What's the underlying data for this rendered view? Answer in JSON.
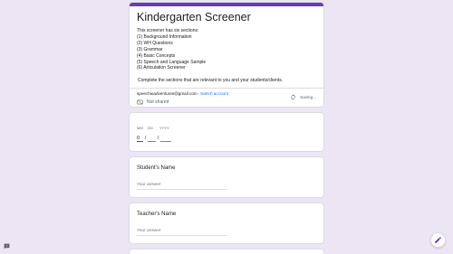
{
  "form": {
    "title": "Kindergarten Screener",
    "description_lines": [
      "This screener has six sections:",
      "(1) Background Information",
      "(2) WH Questions",
      "(3) Grammar",
      "(4) Basic Concepts",
      "(5) Speech and Language Sample",
      "(6) Articulation Screener"
    ],
    "instruction": "Complete the sections that are relevant to you and your students/clients.",
    "account_email": "speechieadventures@gmail.com",
    "switch_account_label": "Switch account",
    "saving_status": "Saving...",
    "shared_status": "Not shared",
    "accent_color": "#673ab7",
    "background_color": "#ece6f4"
  },
  "date_question": {
    "labels": {
      "month": "MM",
      "day": "DD",
      "year": "YYYY"
    },
    "month_value": "0",
    "separator": "/"
  },
  "questions": [
    {
      "title": "Student's Name",
      "placeholder": "Your answer"
    },
    {
      "title": "Teacher's Name",
      "placeholder": "Your answer"
    }
  ],
  "icons": {
    "sync": "sync-icon",
    "cloud": "cloud-off-icon",
    "edit": "pencil-icon",
    "feedback": "feedback-icon"
  }
}
